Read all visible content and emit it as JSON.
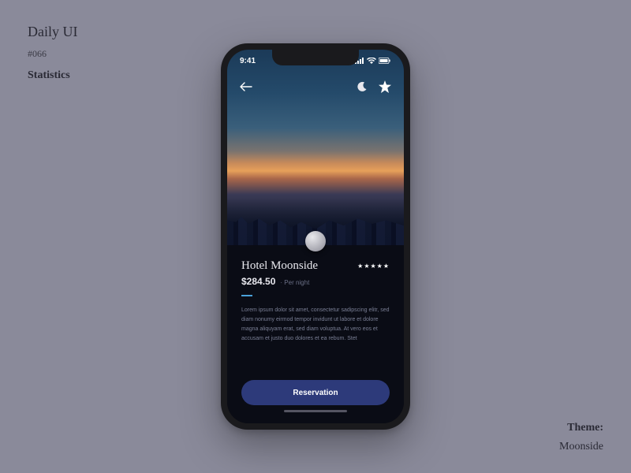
{
  "page": {
    "series": "Daily UI",
    "challenge_number": "#066",
    "challenge_name": "Statistics",
    "theme_label": "Theme:",
    "theme_value": "Moonside"
  },
  "status_bar": {
    "time": "9:41"
  },
  "hotel": {
    "name": "Hotel Moonside",
    "stars": "★★★★★",
    "price": "$284.50",
    "price_unit": "Per night",
    "description": "Lorem ipsum dolor sit amet, consectetur sadipscing elitr, sed diam nonumy eirmod tempor invidunt ut labore et dolore magna aliquyam erat, sed diam voluptua. At vero eos et accusam et justo duo dolores et ea rebum. Stet"
  },
  "actions": {
    "reserve_label": "Reservation"
  },
  "icons": {
    "back": "back-arrow-icon",
    "moon": "moon-icon",
    "star": "star-icon"
  }
}
